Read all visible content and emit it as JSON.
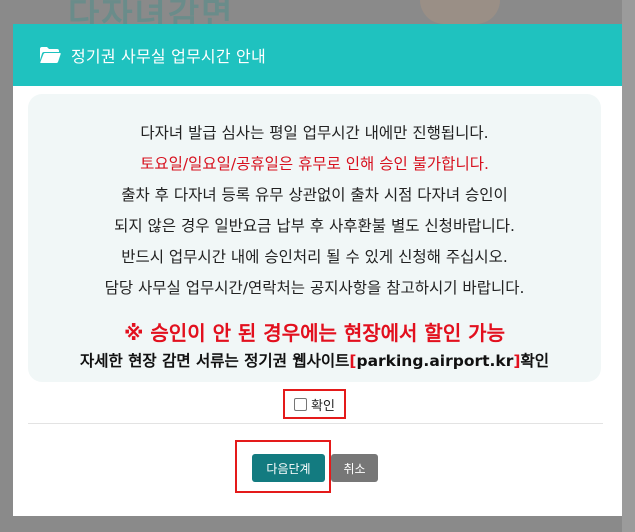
{
  "background": {
    "page_title": "다자녀감면"
  },
  "modal": {
    "title": "정기권 사무실 업무시간 안내",
    "icon": "folder-open-icon",
    "notice": {
      "line1": "다자녀 발급 심사는 평일 업무시간 내에만 진행됩니다.",
      "line2": "토요일/일요일/공휴일은 휴무로 인해 승인 불가합니다.",
      "line3": "출차 후 다자녀 등록 유무 상관없이 출차 시점 다자녀 승인이",
      "line4": "되지 않은 경우 일반요금 납부 후 사후환불 별도 신청바랍니다.",
      "line5": "반드시 업무시간 내에 승인처리 될 수 있게 신청해 주십시오.",
      "line6": "담당 사무실 업무시간/연락처는 공지사항을 참고하시기 바랍니다.",
      "warning": "※ 승인이 안 된 경우에는 현장에서 할인 가능",
      "detail_prefix": "자세한 현장 감면 서류는 정기권 웹사이트",
      "detail_bracket_open": "[",
      "detail_link": "parking.airport.kr",
      "detail_bracket_close": "]",
      "detail_suffix": "확인"
    },
    "confirm": {
      "label": "확인",
      "checked": false
    },
    "buttons": {
      "next": "다음단계",
      "cancel": "취소"
    }
  },
  "colors": {
    "header": "#1fc2bf",
    "notice_bg": "#f1f7f7",
    "warning_red": "#e2101e",
    "next_button": "#137b80",
    "cancel_button": "#777777",
    "highlight_outline": "#e41a1a"
  }
}
